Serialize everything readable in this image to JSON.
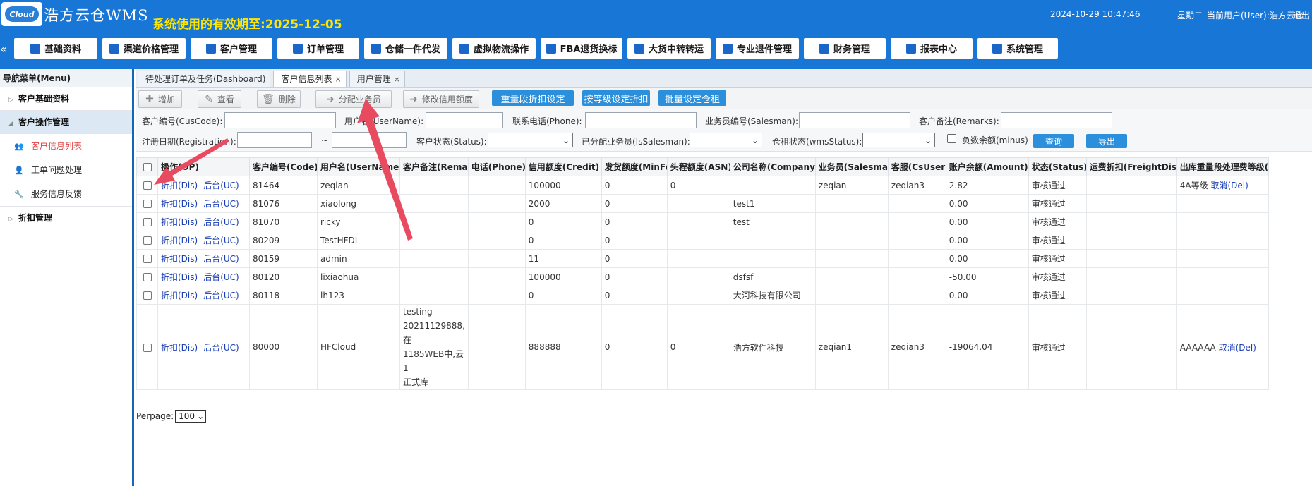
{
  "header": {
    "logo_text": "Cloud",
    "app_title": "浩方云仓WMS",
    "expiry_text": "系统使用的有效期至:2025-12-05",
    "datetime": "2024-10-29 10:47:46",
    "weekday": "星期二",
    "current_user": "当前用户(User):浩方云仓",
    "logout": "退出"
  },
  "nav": {
    "collapse_glyph": "«",
    "items": [
      "基础资料",
      "渠道价格管理",
      "客户管理",
      "订单管理",
      "仓储一件代发",
      "虚拟物流操作",
      "FBA退货换标",
      "大货中转转运",
      "专业退件管理",
      "财务管理",
      "报表中心",
      "系统管理"
    ]
  },
  "sidebar": {
    "title": "导航菜单(Menu)",
    "sections": [
      {
        "label": "客户基础资料"
      },
      {
        "label": "客户操作管理"
      },
      {
        "label": "折扣管理"
      }
    ],
    "items": [
      {
        "label": "客户信息列表"
      },
      {
        "label": "工单问题处理"
      },
      {
        "label": "服务信息反馈"
      }
    ]
  },
  "tabs": [
    {
      "label": "待处理订单及任务(Dashboard)"
    },
    {
      "label": "客户信息列表",
      "close": "×"
    },
    {
      "label": "用户管理",
      "close": "×"
    }
  ],
  "toolbar": {
    "add": "增加",
    "view": "查看",
    "delete": "删除",
    "assign": "分配业务员",
    "modify_credit": "修改信用额度",
    "weight_discount": "重量段折扣设定",
    "level_discount": "按等级设定折扣",
    "batch_rent": "批量设定仓租"
  },
  "filters": {
    "cuscode": "客户编号(CusCode):",
    "username": "用户名(UserName):",
    "phone": "联系电话(Phone):",
    "salesman": "业务员编号(Salesman):",
    "remarks": "客户备注(Remarks):",
    "registration": "注册日期(Registration):",
    "tilde": "~",
    "status": "客户状态(Status):",
    "issalesman": "已分配业务员(IsSalesman):",
    "wmsstatus": "仓租状态(wmsStatus):",
    "minus": "负数余额(minus)",
    "query": "查询",
    "export": "导出"
  },
  "table": {
    "headers": [
      "操作(OP)",
      "客户编号(Code)",
      "用户名(UserName)",
      "客户备注(Remark)",
      "电话(Phone)",
      "信用额度(Credit)",
      "发货额度(MinFee)",
      "头程额度(ASN)",
      "公司名称(Company)",
      "业务员(Salesman)",
      "客服(CsUser)",
      "账户余额(Amount)",
      "状态(Status)",
      "运费折扣(FreightDis)",
      "出库重量段处理费等级(OutProc"
    ],
    "op_dis": "折扣(Dis)",
    "op_uc": "后台(UC)",
    "rows": [
      {
        "code": "81464",
        "user": "zeqian",
        "remark": "",
        "phone": "",
        "credit": "100000",
        "minfee": "0",
        "asn": "0",
        "company": "",
        "salesman": "zeqian",
        "cs": "zeqian3",
        "amount": "2.82",
        "status": "审核通过",
        "freight": "",
        "level": "4A等级",
        "del": "取消(Del)"
      },
      {
        "code": "81076",
        "user": "xiaolong",
        "remark": "",
        "phone": "",
        "credit": "2000",
        "minfee": "0",
        "asn": "",
        "company": "test1",
        "salesman": "",
        "cs": "",
        "amount": "0.00",
        "status": "审核通过",
        "freight": "",
        "level": "",
        "del": ""
      },
      {
        "code": "81070",
        "user": "ricky",
        "remark": "",
        "phone": "",
        "credit": "0",
        "minfee": "0",
        "asn": "",
        "company": "test",
        "salesman": "",
        "cs": "",
        "amount": "0.00",
        "status": "审核通过",
        "freight": "",
        "level": "",
        "del": ""
      },
      {
        "code": "80209",
        "user": "TestHFDL",
        "remark": "",
        "phone": "",
        "credit": "0",
        "minfee": "0",
        "asn": "",
        "company": "",
        "salesman": "",
        "cs": "",
        "amount": "0.00",
        "status": "审核通过",
        "freight": "",
        "level": "",
        "del": ""
      },
      {
        "code": "80159",
        "user": "admin",
        "remark": "",
        "phone": "",
        "credit": "11",
        "minfee": "0",
        "asn": "",
        "company": "",
        "salesman": "",
        "cs": "",
        "amount": "0.00",
        "status": "审核通过",
        "freight": "",
        "level": "",
        "del": ""
      },
      {
        "code": "80120",
        "user": "lixiaohua",
        "remark": "",
        "phone": "",
        "credit": "100000",
        "minfee": "0",
        "asn": "",
        "company": "dsfsf",
        "salesman": "",
        "cs": "",
        "amount": "-50.00",
        "status": "审核通过",
        "freight": "",
        "level": "",
        "del": ""
      },
      {
        "code": "80118",
        "user": "lh123",
        "remark": "",
        "phone": "",
        "credit": "0",
        "minfee": "0",
        "asn": "",
        "company": "大河科技有限公司",
        "salesman": "",
        "cs": "",
        "amount": "0.00",
        "status": "审核通过",
        "freight": "",
        "level": "",
        "del": ""
      },
      {
        "code": "80000",
        "user": "HFCloud",
        "remark": "testing\n20211129888,在\n1185WEB中,云1\n正式库",
        "phone": "",
        "credit": "888888",
        "minfee": "0",
        "asn": "0",
        "company": "浩方软件科技",
        "salesman": "zeqian1",
        "cs": "zeqian3",
        "amount": "-19064.04",
        "status": "审核通过",
        "freight": "",
        "level": "AAAAAA",
        "del": "取消(Del)"
      }
    ]
  },
  "perpage": {
    "label": "Perpage:",
    "value": "100"
  },
  "colors": {
    "header_blue": "#1776d6",
    "expiry_yellow": "#ffe600",
    "accent_blue": "#2b8fdb",
    "annotation_red": "#e84a5f"
  }
}
